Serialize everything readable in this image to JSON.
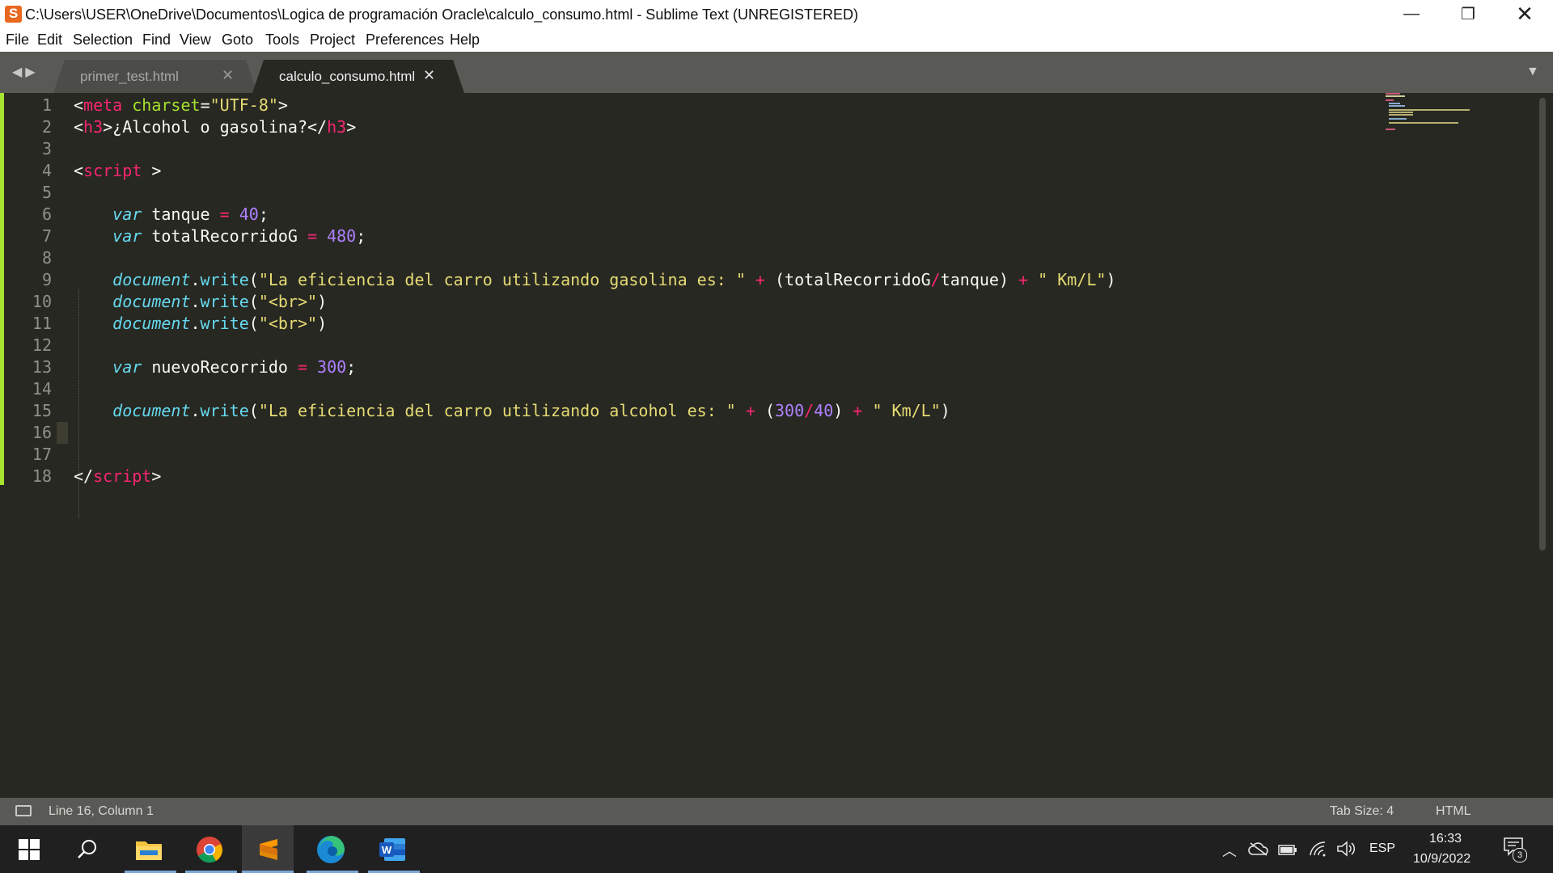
{
  "window": {
    "title": "C:\\Users\\USER\\OneDrive\\Documentos\\Logica de programación Oracle\\calculo_consumo.html - Sublime Text (UNREGISTERED)",
    "minimize_glyph": "—",
    "maximize_glyph": "❐",
    "close_glyph": "✕"
  },
  "menu": [
    "File",
    "Edit",
    "Selection",
    "Find",
    "View",
    "Goto",
    "Tools",
    "Project",
    "Preferences",
    "Help"
  ],
  "tabs": [
    {
      "label": "primer_test.html",
      "active": false,
      "close_glyph": "✕"
    },
    {
      "label": "calculo_consumo.html",
      "active": true,
      "close_glyph": "✕"
    }
  ],
  "tab_nav_glyph": "◀▶",
  "tab_dropdown_glyph": "▼",
  "editor": {
    "current_line": 16,
    "line_numbers": [
      "1",
      "2",
      "3",
      "4",
      "5",
      "6",
      "7",
      "8",
      "9",
      "10",
      "11",
      "12",
      "13",
      "14",
      "15",
      "16",
      "17",
      "18"
    ],
    "lines": [
      [
        [
          "t-plain",
          "<"
        ],
        [
          "t-tag",
          "meta"
        ],
        [
          "t-plain",
          " "
        ],
        [
          "t-attr",
          "charset"
        ],
        [
          "t-plain",
          "="
        ],
        [
          "t-str",
          "\"UTF-8\""
        ],
        [
          "t-plain",
          ">"
        ]
      ],
      [
        [
          "t-plain",
          "<"
        ],
        [
          "t-tag",
          "h3"
        ],
        [
          "t-plain",
          ">¿Alcohol o gasolina?</"
        ],
        [
          "t-tag",
          "h3"
        ],
        [
          "t-plain",
          ">"
        ]
      ],
      [],
      [
        [
          "t-plain",
          "<"
        ],
        [
          "t-tag",
          "script"
        ],
        [
          "t-plain",
          " >"
        ]
      ],
      [],
      [
        [
          "t-plain",
          "    "
        ],
        [
          "t-kw",
          "var"
        ],
        [
          "t-plain",
          " tanque "
        ],
        [
          "t-op",
          "="
        ],
        [
          "t-plain",
          " "
        ],
        [
          "t-num",
          "40"
        ],
        [
          "t-plain",
          ";"
        ]
      ],
      [
        [
          "t-plain",
          "    "
        ],
        [
          "t-kw",
          "var"
        ],
        [
          "t-plain",
          " totalRecorridoG "
        ],
        [
          "t-op",
          "="
        ],
        [
          "t-plain",
          " "
        ],
        [
          "t-num",
          "480"
        ],
        [
          "t-plain",
          ";"
        ]
      ],
      [],
      [
        [
          "t-plain",
          "    "
        ],
        [
          "t-obj",
          "document"
        ],
        [
          "t-plain",
          "."
        ],
        [
          "t-fn",
          "write"
        ],
        [
          "t-plain",
          "("
        ],
        [
          "t-str",
          "\"La eficiencia del carro utilizando gasolina es: \""
        ],
        [
          "t-plain",
          " "
        ],
        [
          "t-op",
          "+"
        ],
        [
          "t-plain",
          " (totalRecorridoG"
        ],
        [
          "t-op",
          "/"
        ],
        [
          "t-plain",
          "tanque) "
        ],
        [
          "t-op",
          "+"
        ],
        [
          "t-plain",
          " "
        ],
        [
          "t-str",
          "\" Km/L\""
        ],
        [
          "t-plain",
          ")"
        ]
      ],
      [
        [
          "t-plain",
          "    "
        ],
        [
          "t-obj",
          "document"
        ],
        [
          "t-plain",
          "."
        ],
        [
          "t-fn",
          "write"
        ],
        [
          "t-plain",
          "("
        ],
        [
          "t-str",
          "\"<br>\""
        ],
        [
          "t-plain",
          ")"
        ]
      ],
      [
        [
          "t-plain",
          "    "
        ],
        [
          "t-obj",
          "document"
        ],
        [
          "t-plain",
          "."
        ],
        [
          "t-fn",
          "write"
        ],
        [
          "t-plain",
          "("
        ],
        [
          "t-str",
          "\"<br>\""
        ],
        [
          "t-plain",
          ")"
        ]
      ],
      [],
      [
        [
          "t-plain",
          "    "
        ],
        [
          "t-kw",
          "var"
        ],
        [
          "t-plain",
          " nuevoRecorrido "
        ],
        [
          "t-op",
          "="
        ],
        [
          "t-plain",
          " "
        ],
        [
          "t-num",
          "300"
        ],
        [
          "t-plain",
          ";"
        ]
      ],
      [],
      [
        [
          "t-plain",
          "    "
        ],
        [
          "t-obj",
          "document"
        ],
        [
          "t-plain",
          "."
        ],
        [
          "t-fn",
          "write"
        ],
        [
          "t-plain",
          "("
        ],
        [
          "t-str",
          "\"La eficiencia del carro utilizando alcohol es: \""
        ],
        [
          "t-plain",
          " "
        ],
        [
          "t-op",
          "+"
        ],
        [
          "t-plain",
          " ("
        ],
        [
          "t-num",
          "300"
        ],
        [
          "t-op",
          "/"
        ],
        [
          "t-num",
          "40"
        ],
        [
          "t-plain",
          ") "
        ],
        [
          "t-op",
          "+"
        ],
        [
          "t-plain",
          " "
        ],
        [
          "t-str",
          "\" Km/L\""
        ],
        [
          "t-plain",
          ")"
        ]
      ],
      [],
      [],
      [
        [
          "t-plain",
          "</"
        ],
        [
          "t-tag",
          "script"
        ],
        [
          "t-plain",
          ">"
        ]
      ]
    ]
  },
  "status": {
    "position": "Line 16, Column 1",
    "tab_size": "Tab Size: 4",
    "syntax": "HTML"
  },
  "taskbar": {
    "apps": [
      {
        "name": "start-button",
        "icon": "windows-logo-icon"
      },
      {
        "name": "search-button",
        "icon": "search-icon"
      },
      {
        "name": "file-explorer",
        "icon": "folder-icon"
      },
      {
        "name": "chrome",
        "icon": "chrome-icon"
      },
      {
        "name": "sublime-text",
        "icon": "sublime-text-icon"
      },
      {
        "name": "edge",
        "icon": "edge-icon"
      },
      {
        "name": "word",
        "icon": "word-icon"
      }
    ],
    "language": "ESP",
    "time": "16:33",
    "date": "10/9/2022",
    "notification_count": "3",
    "colors": {
      "accent": "#7aa7d8",
      "sublime_orange": "#e8691f"
    }
  }
}
